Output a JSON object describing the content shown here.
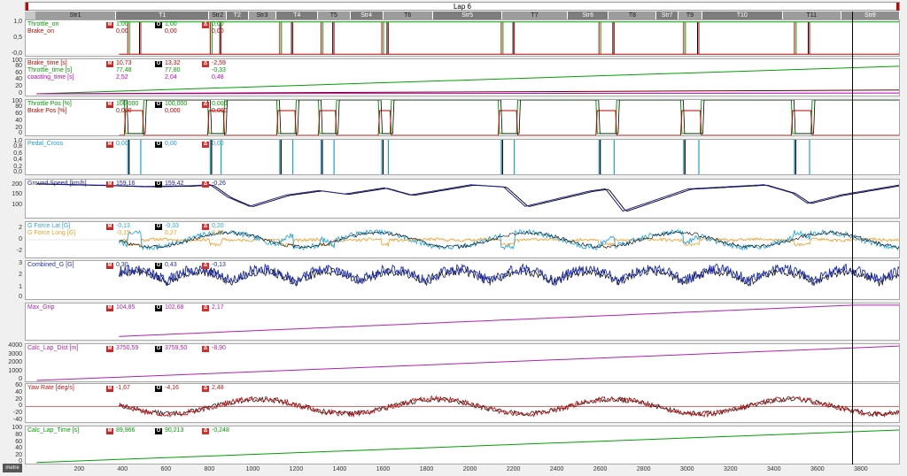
{
  "window": {
    "lap_title": "Lap 6",
    "units_button": "metre",
    "cursor_distance": 3760
  },
  "segments": [
    {
      "label": "Str1",
      "start": 0,
      "end": 370,
      "kind": "str"
    },
    {
      "label": "T1",
      "start": 370,
      "end": 800,
      "kind": "turn"
    },
    {
      "label": "Str2",
      "start": 800,
      "end": 880,
      "kind": "str"
    },
    {
      "label": "T2",
      "start": 880,
      "end": 980,
      "kind": "turn"
    },
    {
      "label": "Str3",
      "start": 980,
      "end": 1110,
      "kind": "str"
    },
    {
      "label": "T4",
      "start": 1110,
      "end": 1300,
      "kind": "turn"
    },
    {
      "label": "T5",
      "start": 1300,
      "end": 1450,
      "kind": "str"
    },
    {
      "label": "Str4",
      "start": 1450,
      "end": 1600,
      "kind": "turn"
    },
    {
      "label": "T6",
      "start": 1600,
      "end": 1830,
      "kind": "str"
    },
    {
      "label": "Str5",
      "start": 1830,
      "end": 2150,
      "kind": "turn"
    },
    {
      "label": "T7",
      "start": 2150,
      "end": 2450,
      "kind": "str"
    },
    {
      "label": "Str6",
      "start": 2450,
      "end": 2640,
      "kind": "turn"
    },
    {
      "label": "T8",
      "start": 2640,
      "end": 2860,
      "kind": "str"
    },
    {
      "label": "Str7",
      "start": 2860,
      "end": 2960,
      "kind": "turn"
    },
    {
      "label": "T9",
      "start": 2960,
      "end": 3070,
      "kind": "str"
    },
    {
      "label": "T10",
      "start": 3070,
      "end": 3440,
      "kind": "turn"
    },
    {
      "label": "T11",
      "start": 3440,
      "end": 3710,
      "kind": "str"
    },
    {
      "label": "Str8",
      "start": 3710,
      "end": 3980,
      "kind": "cur"
    }
  ],
  "chart_data": {
    "type": "line",
    "x_axis": {
      "unit_button": "metre",
      "xlim": [
        -50,
        3980
      ],
      "ticks": [
        200,
        400,
        600,
        800,
        1000,
        1200,
        1400,
        1600,
        1800,
        2000,
        2200,
        2400,
        2600,
        2800,
        3000,
        3200,
        3400,
        3600,
        3800
      ]
    },
    "panels": [
      {
        "id": "on-off",
        "ylim": [
          -0.05,
          1.05
        ],
        "yticks": [
          "1,0",
          "0,5",
          "-0,0"
        ],
        "series": [
          {
            "name": "Throttle_on",
            "color": "#00a000",
            "M": "1,00",
            "O": "1,00",
            "D": "0,00"
          },
          {
            "name": "Brake_on",
            "color": "#c00000",
            "M": "0,00",
            "O": "0,00",
            "D": "0,00"
          }
        ],
        "brake_zones": [
          [
            420,
            480
          ],
          [
            800,
            850
          ],
          [
            1120,
            1180
          ],
          [
            1310,
            1370
          ],
          [
            1590,
            1620
          ],
          [
            2140,
            2200
          ],
          [
            2590,
            2660
          ],
          [
            2980,
            3050
          ],
          [
            3490,
            3560
          ]
        ]
      },
      {
        "id": "times",
        "ylim": [
          -5,
          100
        ],
        "yticks": [
          "100",
          "80",
          "60",
          "40",
          "20",
          "0"
        ],
        "series": [
          {
            "name": "Brake_time [s]",
            "color": "#c00000",
            "M": "10,73",
            "O": "13,32",
            "D": "-2,59"
          },
          {
            "name": "Throttle_time [s]",
            "color": "#00a000",
            "M": "77,48",
            "O": "77,80",
            "D": "-0,33"
          },
          {
            "name": "coasting_time [s]",
            "color": "#c000c0",
            "M": "2,52",
            "O": "2,04",
            "D": "0,48"
          }
        ]
      },
      {
        "id": "pedal-pos",
        "ylim": [
          0,
          100
        ],
        "yticks": [
          "100",
          "80",
          "60",
          "40",
          "20",
          "0"
        ],
        "series": [
          {
            "name": "Throttle Pos [%]",
            "color": "#00a000",
            "M": "100,000",
            "O": "100,000",
            "D": "0,000"
          },
          {
            "name": "Brake Pos [%]",
            "color": "#c00000",
            "M": "0,000",
            "O": "0,000",
            "D": "0,000"
          }
        ]
      },
      {
        "id": "pedal-cross",
        "ylim": [
          0,
          1
        ],
        "yticks": [
          "1,0",
          "0,8",
          "0,6",
          "0,4",
          "0,2",
          "0,0"
        ],
        "series": [
          {
            "name": "Pedal_Cross",
            "color": "#1aa0d8",
            "M": "0,00",
            "O": "0,00",
            "D": "0,00"
          }
        ]
      },
      {
        "id": "speed",
        "ylim": [
          40,
          225
        ],
        "yticks": [
          "200",
          "150",
          "100"
        ],
        "series": [
          {
            "name": "Ground Speed [km/h]",
            "color": "#2020a0",
            "M": "159,16",
            "O": "159,42",
            "D": "-0,26"
          }
        ],
        "points_x": [
          0,
          300,
          500,
          700,
          800,
          880,
          980,
          1150,
          1300,
          1420,
          1600,
          1720,
          2000,
          2150,
          2250,
          2550,
          2620,
          2700,
          3000,
          3350,
          3480,
          3550,
          3700,
          3980
        ],
        "points_y": [
          205,
          198,
          192,
          195,
          200,
          140,
          95,
          150,
          172,
          155,
          185,
          150,
          200,
          190,
          95,
          170,
          180,
          72,
          180,
          200,
          160,
          110,
          150,
          200
        ]
      },
      {
        "id": "g-force",
        "ylim": [
          -3,
          3
        ],
        "yticks": [
          "2",
          "0",
          "-2"
        ],
        "series": [
          {
            "name": "G Force Lat [G]",
            "color": "#29a8e0",
            "M": "-0,13",
            "O": "-0,33",
            "D": "0,20"
          },
          {
            "name": "G Force Long [G]",
            "color": "#f0a020",
            "M": "-0,15",
            "O": "0,27",
            "D": "0,42"
          }
        ]
      },
      {
        "id": "combined-g",
        "ylim": [
          0,
          3.2
        ],
        "yticks": [
          "3",
          "2",
          "1",
          "0"
        ],
        "series": [
          {
            "name": "Combined_G [G]",
            "color": "#1f2fb0",
            "M": "0,30",
            "O": "0,43",
            "D": "-0,13"
          }
        ]
      },
      {
        "id": "max-grip",
        "ylim": [
          0,
          110
        ],
        "yticks": [],
        "series": [
          {
            "name": "Max_Grip",
            "color": "#b020b0",
            "M": "104,85",
            "O": "102,68",
            "D": "2,17"
          }
        ]
      },
      {
        "id": "lap-dist",
        "ylim": [
          -100,
          4200
        ],
        "yticks": [
          "4000",
          "3000",
          "2000",
          "1000",
          "0"
        ],
        "series": [
          {
            "name": "Calc_Lap_Dist [m]",
            "color": "#b020b0",
            "M": "3750,59",
            "O": "3759,50",
            "D": "-8,90"
          }
        ]
      },
      {
        "id": "yaw-rate",
        "ylim": [
          -45,
          65
        ],
        "yticks": [
          "60",
          "40",
          "20",
          "0",
          "-20",
          "-40"
        ],
        "series": [
          {
            "name": "Yaw Rate [deg/s]",
            "color": "#c01818",
            "M": "-1,67",
            "O": "-4,16",
            "D": "2,48"
          }
        ]
      },
      {
        "id": "lap-time",
        "ylim": [
          -3,
          105
        ],
        "yticks": [
          "100",
          "80",
          "60",
          "40",
          "20",
          "0"
        ],
        "series": [
          {
            "name": "Calc_Lap_Time [s]",
            "color": "#00a000",
            "M": "89,966",
            "O": "90,213",
            "D": "-0,248"
          }
        ]
      }
    ]
  },
  "badges": {
    "m": "M",
    "o": "O",
    "d": "Δ"
  }
}
